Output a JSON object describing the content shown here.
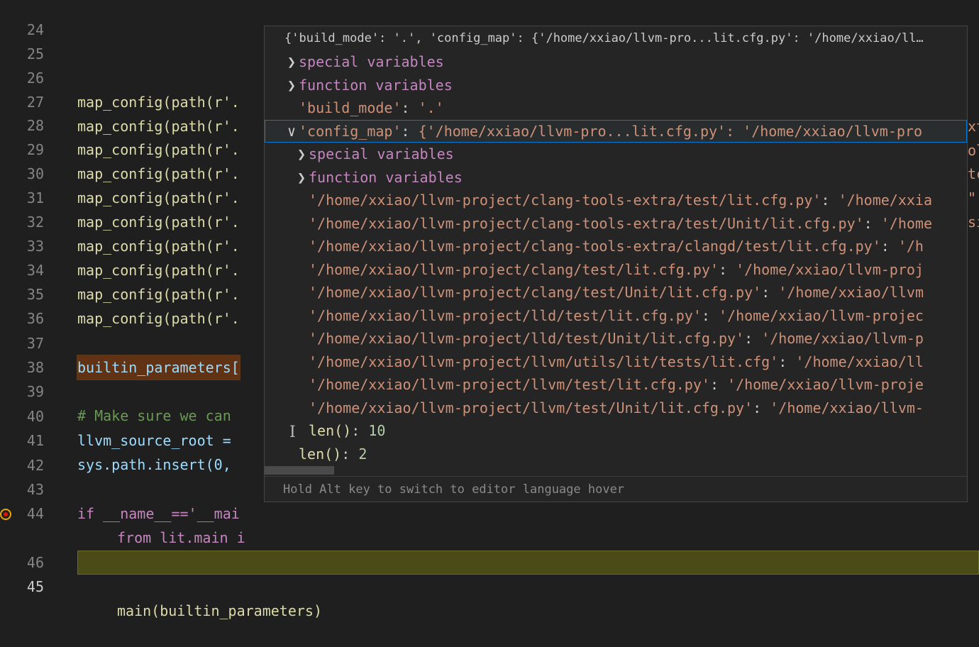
{
  "editor": {
    "lines": [
      {
        "n": "24"
      },
      {
        "n": "25"
      },
      {
        "n": "26",
        "code": "map_config(path(r'."
      },
      {
        "n": "27",
        "code": "map_config(path(r'."
      },
      {
        "n": "28",
        "code": "map_config(path(r'."
      },
      {
        "n": "29",
        "code": "map_config(path(r'."
      },
      {
        "n": "30",
        "code": "map_config(path(r'."
      },
      {
        "n": "31",
        "code": "map_config(path(r'."
      },
      {
        "n": "32",
        "code": "map_config(path(r'."
      },
      {
        "n": "33",
        "code": "map_config(path(r'."
      },
      {
        "n": "34",
        "code": "map_config(path(r'."
      },
      {
        "n": "35",
        "code": "map_config(path(r'."
      },
      {
        "n": "36"
      },
      {
        "n": "37",
        "code": "builtin_parameters["
      },
      {
        "n": "38"
      },
      {
        "n": "39",
        "code": "# Make sure we can"
      },
      {
        "n": "40",
        "code": "llvm_source_root ="
      },
      {
        "n": "41",
        "code": "sys.path.insert(0,"
      },
      {
        "n": "42"
      },
      {
        "n": "43",
        "code": "if __name__=='__mai"
      },
      {
        "n": "44",
        "code": "from lit.main i"
      },
      {
        "n": "45",
        "code": "main(builtin_parameters)"
      },
      {
        "n": "46"
      }
    ],
    "right_fragments": [
      "xt",
      "ol",
      "tc",
      "\"",
      "si"
    ]
  },
  "hover": {
    "title": "{'build_mode': '.', 'config_map': {'/home/xxiao/llvm-pro...lit.cfg.py': '/home/xxiao/ll…",
    "rows": [
      {
        "chev": ">",
        "label": "special variables",
        "kind": "group",
        "indent": 0
      },
      {
        "chev": ">",
        "label": "function variables",
        "kind": "group",
        "indent": 0
      },
      {
        "key": "'build_mode'",
        "sep": ": ",
        "val": "'.'",
        "indent": 0
      },
      {
        "chev": "v",
        "key": "'config_map'",
        "sep": ": ",
        "val": "{'/home/xxiao/llvm-pro...lit.cfg.py': '/home/xxiao/llvm-pro",
        "indent": 0,
        "selected": true
      },
      {
        "chev": ">",
        "label": "special variables",
        "kind": "group",
        "indent": 1
      },
      {
        "chev": ">",
        "label": "function variables",
        "kind": "group",
        "indent": 1
      },
      {
        "key": "'/home/xxiao/llvm-project/clang-tools-extra/test/lit.cfg.py'",
        "sep": ": ",
        "val": "'/home/xxia",
        "indent": 1
      },
      {
        "key": "'/home/xxiao/llvm-project/clang-tools-extra/test/Unit/lit.cfg.py'",
        "sep": ": ",
        "val": "'/home",
        "indent": 1
      },
      {
        "key": "'/home/xxiao/llvm-project/clang-tools-extra/clangd/test/lit.cfg.py'",
        "sep": ": ",
        "val": "'/h",
        "indent": 1
      },
      {
        "key": "'/home/xxiao/llvm-project/clang/test/lit.cfg.py'",
        "sep": ": ",
        "val": "'/home/xxiao/llvm-proj",
        "indent": 1
      },
      {
        "key": "'/home/xxiao/llvm-project/clang/test/Unit/lit.cfg.py'",
        "sep": ": ",
        "val": "'/home/xxiao/llvm",
        "indent": 1
      },
      {
        "key": "'/home/xxiao/llvm-project/lld/test/lit.cfg.py'",
        "sep": ": ",
        "val": "'/home/xxiao/llvm-projec",
        "indent": 1
      },
      {
        "key": "'/home/xxiao/llvm-project/lld/test/Unit/lit.cfg.py'",
        "sep": ": ",
        "val": "'/home/xxiao/llvm-p",
        "indent": 1
      },
      {
        "key": "'/home/xxiao/llvm-project/llvm/utils/lit/tests/lit.cfg'",
        "sep": ": ",
        "val": "'/home/xxiao/ll",
        "indent": 1
      },
      {
        "key": "'/home/xxiao/llvm-project/llvm/test/lit.cfg.py'",
        "sep": ": ",
        "val": "'/home/xxiao/llvm-proje",
        "indent": 1
      },
      {
        "key": "'/home/xxiao/llvm-project/llvm/test/Unit/lit.cfg.py'",
        "sep": ": ",
        "val": "'/home/xxiao/llvm-",
        "indent": 1
      },
      {
        "fn": "len()",
        "sep": ": ",
        "num": "10",
        "indent": 1
      },
      {
        "fn": "len()",
        "sep": ": ",
        "num": "2",
        "indent": 0
      }
    ],
    "footer": "Hold Alt key to switch to editor language hover"
  },
  "colors": {
    "accent": "#0078d4",
    "current_line": "#4b4b18",
    "string": "#ce9178",
    "number": "#b5cea8"
  }
}
